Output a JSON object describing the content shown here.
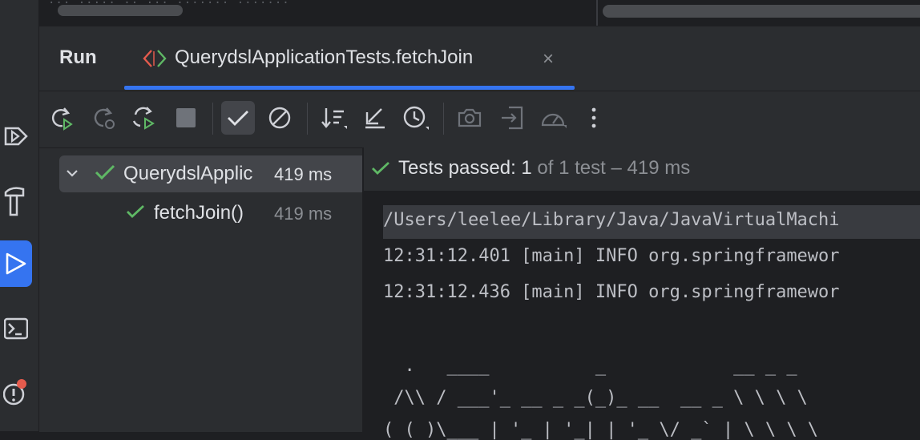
{
  "editor": {
    "text": "... ..... .. ... ....... ......."
  },
  "toolwindow": {
    "title": "Run",
    "tab": {
      "label": "QuerydslApplicationTests.fetchJoin",
      "close": "×"
    }
  },
  "toolbar": {
    "icons": [
      "rerun-icon",
      "rerun-failed-icon",
      "rerun-auto-icon",
      "stop-icon",
      "show-passed-icon",
      "show-ignored-icon",
      "sort-icon",
      "import-icon",
      "history-icon",
      "camera-icon",
      "export-icon",
      "gauge-icon",
      "more-icon"
    ]
  },
  "tree": {
    "root": {
      "label": "QuerydslApplic",
      "time": "419 ms",
      "status": "passed"
    },
    "child": {
      "label": "fetchJoin()",
      "time": "419 ms",
      "status": "passed"
    }
  },
  "console": {
    "status_pass": "Tests passed: 1",
    "status_rest": " of 1 test – 419 ms",
    "lines": [
      "/Users/leelee/Library/Java/JavaVirtualMachi",
      "12:31:12.401 [main] INFO org.springframewor",
      "12:31:12.436 [main] INFO org.springframewor",
      "",
      "  .   ____          _            __ _ _",
      " /\\\\ / ___'_ __ _ _(_)_ __  __ _ \\ \\ \\ \\",
      "( ( )\\___ | '_ | '_| | '_ \\/ _` | \\ \\ \\ \\"
    ]
  },
  "colors": {
    "accent": "#3574f0",
    "passed": "#5fb865",
    "badge": "#e55b4d"
  }
}
